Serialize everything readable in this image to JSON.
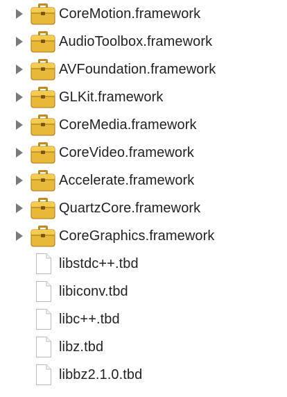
{
  "frameworks": [
    {
      "label": "CoreMotion.framework",
      "icon": "framework-folder-icon"
    },
    {
      "label": "AudioToolbox.framework",
      "icon": "framework-folder-icon"
    },
    {
      "label": "AVFoundation.framework",
      "icon": "framework-folder-icon"
    },
    {
      "label": "GLKit.framework",
      "icon": "framework-folder-icon"
    },
    {
      "label": "CoreMedia.framework",
      "icon": "framework-folder-icon"
    },
    {
      "label": "CoreVideo.framework",
      "icon": "framework-folder-icon"
    },
    {
      "label": "Accelerate.framework",
      "icon": "framework-folder-icon"
    },
    {
      "label": "QuartzCore.framework",
      "icon": "framework-folder-icon"
    },
    {
      "label": "CoreGraphics.framework",
      "icon": "framework-folder-icon"
    }
  ],
  "libraries": [
    {
      "label": "libstdc++.tbd",
      "icon": "document-icon"
    },
    {
      "label": "libiconv.tbd",
      "icon": "document-icon"
    },
    {
      "label": "libc++.tbd",
      "icon": "document-icon"
    },
    {
      "label": "libz.tbd",
      "icon": "document-icon"
    },
    {
      "label": "libbz2.1.0.tbd",
      "icon": "document-icon"
    }
  ],
  "colors": {
    "folder_body": "#e9b93a",
    "folder_tab": "#d89f22",
    "folder_outline": "#a8751a",
    "disclosure": "#7a7a7a",
    "doc_outline": "#bdbdbd"
  }
}
